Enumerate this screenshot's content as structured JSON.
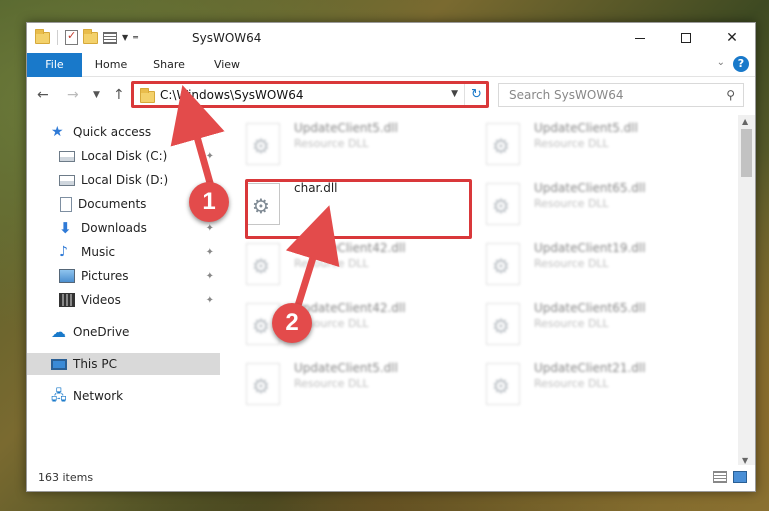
{
  "window": {
    "title": "SysWOW64"
  },
  "ribbon": {
    "tabs": [
      "File",
      "Home",
      "Share",
      "View"
    ]
  },
  "navigation": {
    "address": "C:\\Windows\\SysWOW64",
    "search_placeholder": "Search SysWOW64"
  },
  "sidebar": {
    "items": [
      {
        "label": "Quick access",
        "icon": "star-icon",
        "pinned": false
      },
      {
        "label": "Local Disk (C:)",
        "icon": "disk-icon",
        "pinned": true
      },
      {
        "label": "Local Disk (D:)",
        "icon": "disk-icon",
        "pinned": false
      },
      {
        "label": "Documents",
        "icon": "documents-icon",
        "pinned": true
      },
      {
        "label": "Downloads",
        "icon": "download-icon",
        "pinned": true
      },
      {
        "label": "Music",
        "icon": "music-icon",
        "pinned": true
      },
      {
        "label": "Pictures",
        "icon": "pictures-icon",
        "pinned": true
      },
      {
        "label": "Videos",
        "icon": "videos-icon",
        "pinned": true
      },
      {
        "label": "OneDrive",
        "icon": "cloud-icon",
        "pinned": false
      },
      {
        "label": "This PC",
        "icon": "computer-icon",
        "pinned": false,
        "selected": true
      },
      {
        "label": "Network",
        "icon": "network-icon",
        "pinned": false
      }
    ]
  },
  "files": {
    "highlighted": {
      "name": "char.dll"
    },
    "background": [
      {
        "name": "UpdateClient5.dll",
        "type": "Resource DLL"
      },
      {
        "name": "UpdateClient5.dll",
        "type": "Resource DLL"
      },
      {
        "name": "UpdateClient65.dll",
        "type": "Resource DLL"
      },
      {
        "name": "UpdateClient42.dll",
        "type": "Resource DLL"
      },
      {
        "name": "UpdateClient19.dll",
        "type": "Resource DLL"
      },
      {
        "name": "UpdateClient42.dll",
        "type": "Resource DLL"
      },
      {
        "name": "UpdateClient65.dll",
        "type": "Resource DLL"
      },
      {
        "name": "UpdateClient5.dll",
        "type": "Resource DLL"
      },
      {
        "name": "UpdateClient21.dll",
        "type": "Resource DLL"
      }
    ]
  },
  "status": {
    "item_count": "163 items"
  },
  "annotations": {
    "step1": "1",
    "step2": "2",
    "color": "#e34b4b"
  }
}
